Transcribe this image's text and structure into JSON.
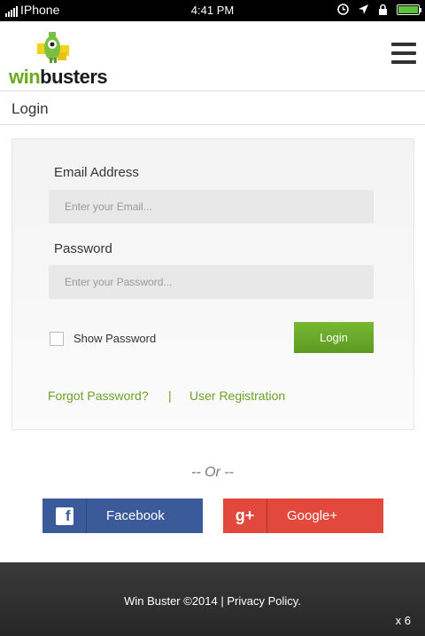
{
  "statusbar": {
    "carrier": "IPhone",
    "time": "4:41 PM"
  },
  "logo": {
    "win": "win",
    "busters": "busters"
  },
  "page": {
    "title": "Login"
  },
  "form": {
    "email_label": "Email Address",
    "email_placeholder": "Enter your Email...",
    "email_value": "",
    "password_label": "Password",
    "password_placeholder": "Enter your Password...",
    "password_value": "",
    "show_password_label": "Show Password",
    "show_password_checked": false,
    "login_label": "Login",
    "forgot_label": "Forgot Password?",
    "separator": "|",
    "register_label": "User Registration"
  },
  "divider": {
    "or_text": "-- Or --"
  },
  "social": {
    "facebook_label": "Facebook",
    "google_label": "Google+"
  },
  "footer": {
    "copyright": "Win Buster ©2014 | ",
    "privacy_label": "Privacy Policy.",
    "zoom": "x 6"
  },
  "colors": {
    "accent": "#6aa229",
    "facebook": "#3b5a9a",
    "google": "#e2483b",
    "footer": "#2e2e2e"
  },
  "icons": [
    "signal-icon",
    "clock-icon",
    "location-arrow-icon",
    "lock-icon",
    "battery-icon",
    "hamburger-menu-icon",
    "facebook-icon",
    "google-plus-icon"
  ]
}
